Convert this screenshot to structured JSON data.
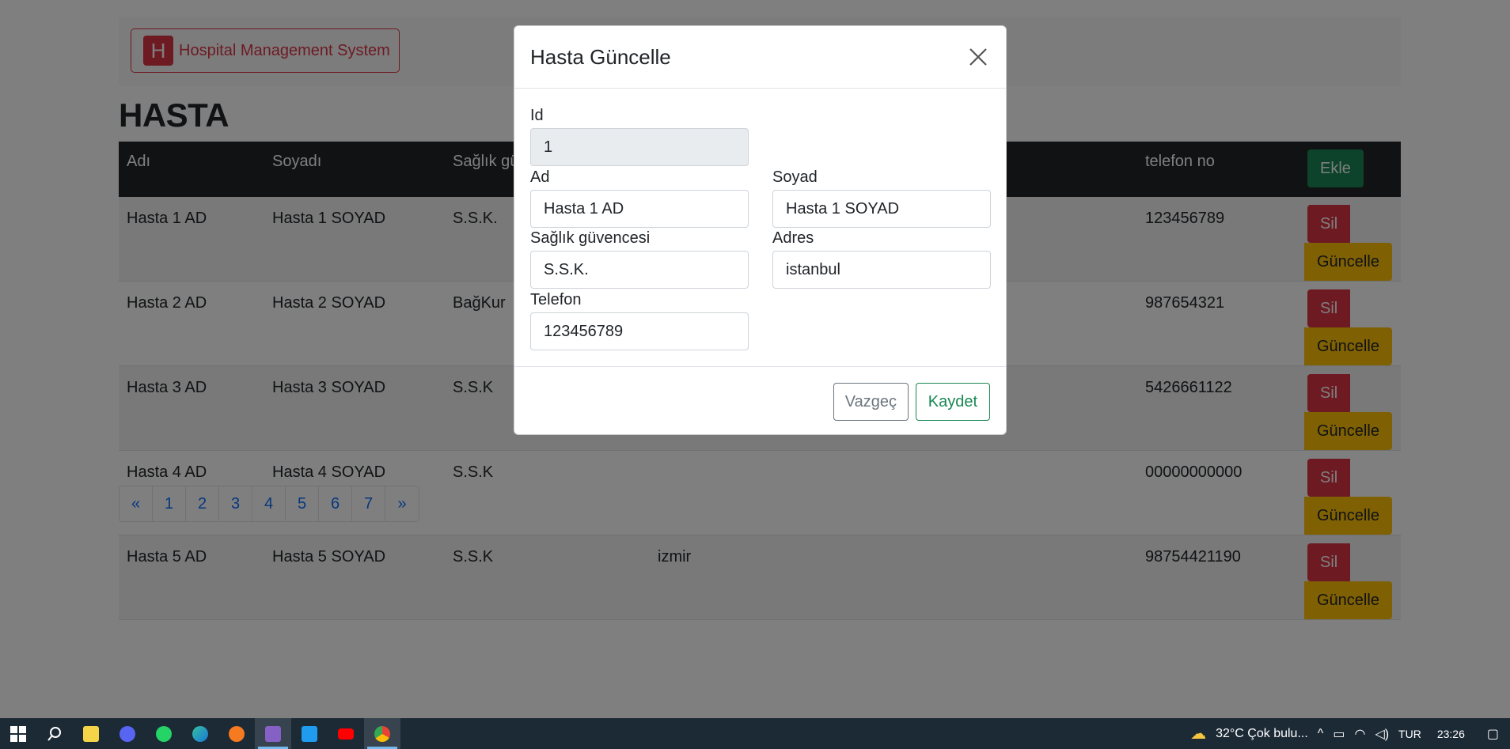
{
  "navbar": {
    "brand_letter": "H",
    "brand_text": "Hospital Management System"
  },
  "page_title": "HASTA",
  "table": {
    "headers": [
      "Adı",
      "Soyadı",
      "Sağlık gü",
      "",
      "telefon no"
    ],
    "add_button": "Ekle",
    "rows": [
      {
        "ad": "Hasta 1 AD",
        "soyad": "Hasta 1 SOYAD",
        "saglik": "S.S.K.",
        "adres": "",
        "telefon": "123456789"
      },
      {
        "ad": "Hasta 2 AD",
        "soyad": "Hasta 2 SOYAD",
        "saglik": "BağKur",
        "adres": "",
        "telefon": "987654321"
      },
      {
        "ad": "Hasta 3 AD",
        "soyad": "Hasta 3 SOYAD",
        "saglik": "S.S.K",
        "adres": "",
        "telefon": "5426661122"
      },
      {
        "ad": "Hasta 4 AD",
        "soyad": "Hasta 4 SOYAD",
        "saglik": "S.S.K",
        "adres": "",
        "telefon": "00000000000"
      },
      {
        "ad": "Hasta 5 AD",
        "soyad": "Hasta 5 SOYAD",
        "saglik": "S.S.K",
        "adres": "izmir",
        "telefon": "98754421190"
      }
    ],
    "delete_label": "Sil",
    "update_label": "Güncelle"
  },
  "pagination": [
    "«",
    "1",
    "2",
    "3",
    "4",
    "5",
    "6",
    "7",
    "»"
  ],
  "modal": {
    "title": "Hasta Güncelle",
    "fields": {
      "id": {
        "label": "Id",
        "value": "1"
      },
      "ad": {
        "label": "Ad",
        "value": "Hasta 1 AD"
      },
      "soyad": {
        "label": "Soyad",
        "value": "Hasta 1 SOYAD"
      },
      "saglik": {
        "label": "Sağlık güvencesi",
        "value": "S.S.K."
      },
      "adres": {
        "label": "Adres",
        "value": "istanbul"
      },
      "telefon": {
        "label": "Telefon",
        "value": "123456789"
      }
    },
    "cancel_label": "Vazgeç",
    "save_label": "Kaydet"
  },
  "taskbar": {
    "weather": "32°C  Çok bulu...",
    "language": "TUR",
    "time": "23:26",
    "apps": [
      "start-icon",
      "search-icon",
      "sticky-notes-icon",
      "discord-icon",
      "whatsapp-icon",
      "edge-icon",
      "blender-icon",
      "visual-studio-icon",
      "vscode-icon",
      "youtube-icon",
      "chrome-icon"
    ]
  },
  "colors": {
    "danger": "#dc3545",
    "warning": "#ffc107",
    "success": "#198754",
    "dark": "#212529",
    "taskbar": "#1c2a36"
  }
}
